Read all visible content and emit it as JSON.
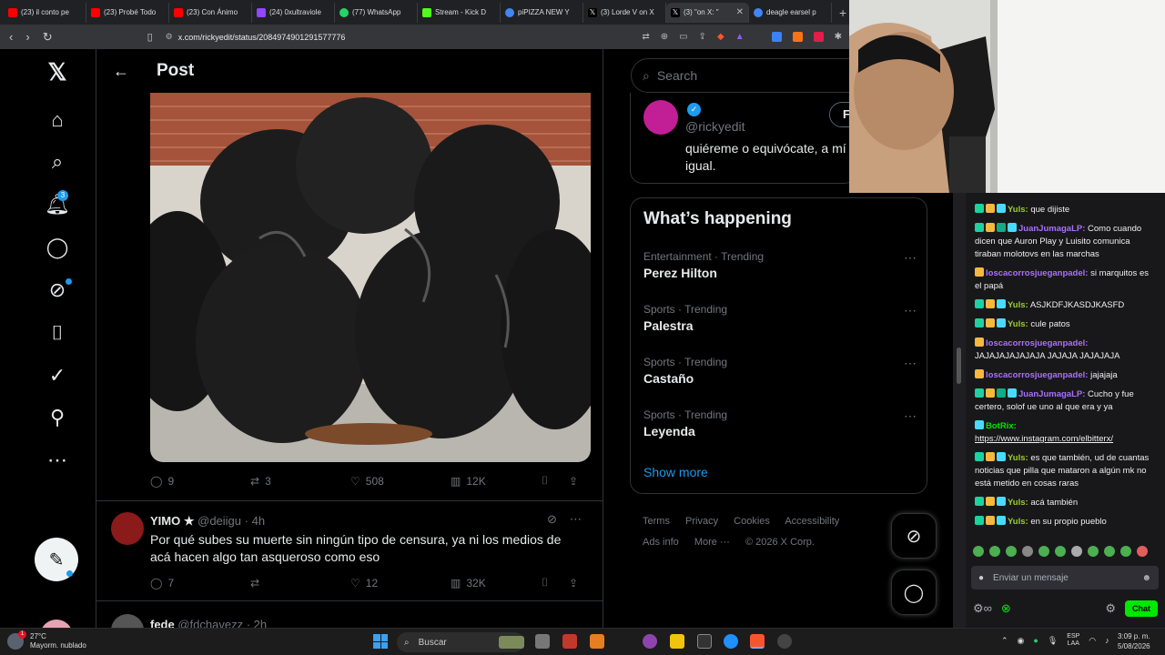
{
  "browser": {
    "tabs": [
      {
        "label": "(23) il conto pe",
        "color": "#ff0000"
      },
      {
        "label": "(23) Probé Todo",
        "color": "#ff0000"
      },
      {
        "label": "(23) Con Ánimo",
        "color": "#ff0000"
      },
      {
        "label": "(24) 0xultraviole",
        "color": "#9146ff"
      },
      {
        "label": "(77) WhatsApp",
        "color": "#25d366"
      },
      {
        "label": "Stream - Kick D",
        "color": "#53fc18"
      },
      {
        "label": "piPIZZA NEW Y",
        "color": "#4285f4"
      },
      {
        "label": "(3) Lorde V on X",
        "color": "#000000"
      },
      {
        "label": "(3) \"on X: \"",
        "color": "#000000"
      },
      {
        "label": "deagle earsel p",
        "color": "#4285f4"
      }
    ],
    "url": "x.com/rickyedit/status/2084974901291577776"
  },
  "x": {
    "notifications_count": "3",
    "page_title": "Post",
    "post_metrics": {
      "replies": "9",
      "reposts": "3",
      "likes": "508",
      "views": "12K"
    },
    "reply": {
      "name": "YIMO ★",
      "handle": "@deiigu",
      "time": "· 4h",
      "text": "Por qué subes su muerte sin ningún tipo de censura, ya ni los medios de acá hacen algo tan asqueroso como eso",
      "metrics": {
        "replies": "7",
        "reposts": "",
        "likes": "12",
        "views": "32K"
      }
    },
    "reply2": {
      "name": "fede",
      "handle": "@fdchavezz",
      "time": "· 2h"
    },
    "search_placeholder": "Search",
    "who": {
      "handle": "@rickyedit",
      "bio": "quiéreme o equivócate, a mí igual.",
      "follow": "F"
    },
    "happening": {
      "title": "What’s happening",
      "trends": [
        {
          "meta": "Entertainment · Trending",
          "name": "Perez Hilton"
        },
        {
          "meta": "Sports · Trending",
          "name": "Palestra"
        },
        {
          "meta": "Sports · Trending",
          "name": "Castaño"
        },
        {
          "meta": "Sports · Trending",
          "name": "Leyenda"
        }
      ],
      "show_more": "Show more"
    },
    "footer": [
      "Terms",
      "Privacy",
      "Cookies",
      "Accessibility",
      "Ads info",
      "More ···",
      "© 2026 X Corp."
    ]
  },
  "chat": {
    "messages": [
      {
        "user": "Yuls:",
        "text": "que dijiste",
        "color": "#9acd32"
      },
      {
        "user": "JuanJumagaLP:",
        "text": "Como cuando dicen que Auron Play y Luisito comunica tiraban molotovs en las marchas",
        "color": "#a970ff"
      },
      {
        "user": "loscacorrosjueganpadel:",
        "text": "si marquitos es el papá",
        "color": "#a970ff"
      },
      {
        "user": "Yuls:",
        "text": "ASJKDFJKASDJKASFD",
        "color": "#9acd32"
      },
      {
        "user": "Yuls:",
        "text": "cule patos",
        "color": "#9acd32"
      },
      {
        "user": "loscacorrosjueganpadel:",
        "text": "JAJAJAJAJAJAJA JAJAJA JAJAJAJA",
        "color": "#a970ff"
      },
      {
        "user": "loscacorrosjueganpadel:",
        "text": "jajajaja",
        "color": "#a970ff"
      },
      {
        "user": "JuanJumagaLP:",
        "text": "Cucho y fue certero, solof ue uno al que era y ya",
        "color": "#a970ff"
      },
      {
        "user": "BotRix:",
        "text": "https://www.instagram.com/elbitterx/",
        "color": "#00e701"
      },
      {
        "user": "Yuls:",
        "text": "es que también, ud de cuantas noticias que pilla que mataron a algún mk no está metido en cosas raras",
        "color": "#9acd32"
      },
      {
        "user": "Yuls:",
        "text": "acá también",
        "color": "#9acd32"
      },
      {
        "user": "Yuls:",
        "text": "en su propio pueblo",
        "color": "#9acd32"
      }
    ],
    "input_placeholder": "Enviar un mensaje",
    "chat_button": "Chat"
  },
  "taskbar": {
    "temp": "27°C",
    "weather": "Mayorm. nublado",
    "weather_badge": "1",
    "search": "Buscar",
    "lang": "ESP",
    "lang2": "LAA",
    "time": "3:09 p. m.",
    "date": "5/08/2026"
  }
}
